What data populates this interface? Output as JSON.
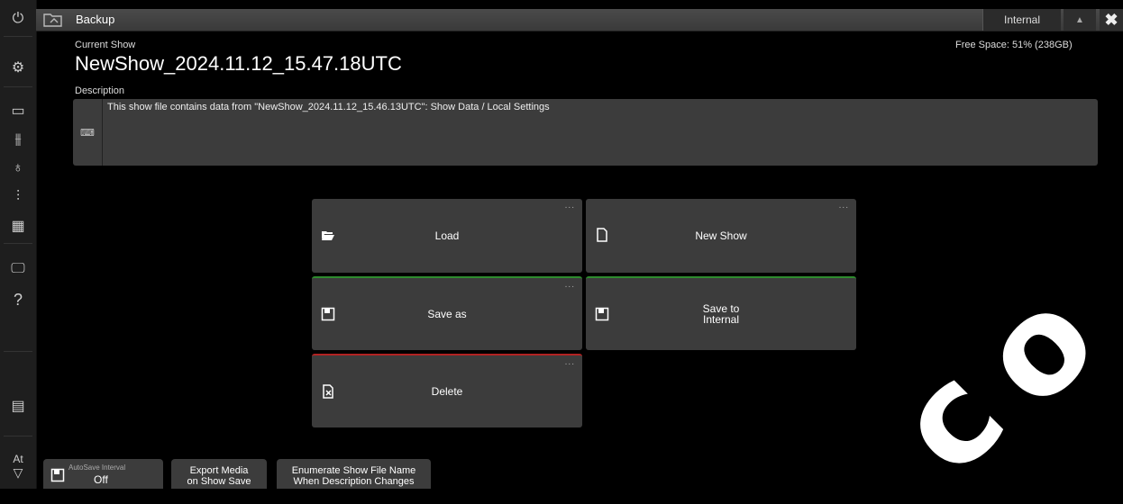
{
  "window": {
    "title": "Backup",
    "destination": "Internal",
    "eject_icon": "eject-icon",
    "close_icon": "close-icon"
  },
  "sidebar": {
    "items": [
      {
        "icon": "power-icon"
      },
      {
        "icon": "gear-icon"
      },
      {
        "icon": "window-icon"
      },
      {
        "icon": "faders-icon"
      },
      {
        "icon": "fixture-icon"
      },
      {
        "icon": "channel-sliders-icon"
      },
      {
        "icon": "grid-icon"
      },
      {
        "icon": "monitor-icon"
      },
      {
        "icon": "help-icon",
        "label": "?"
      },
      {
        "icon": "sheet-icon"
      },
      {
        "icon": "filter-icon",
        "label": "At"
      }
    ]
  },
  "show": {
    "current_label": "Current Show",
    "name": "NewShow_2024.11.12_15.47.18UTC",
    "free_space": "Free Space: 51% (238GB)",
    "description_label": "Description",
    "description": "This show file contains data from \"NewShow_2024.11.12_15.46.13UTC\": Show Data / Local Settings"
  },
  "actions": {
    "load": "Load",
    "new_show": "New Show",
    "save_as": "Save as",
    "save_to_internal_line1": "Save to",
    "save_to_internal_line2": "Internal",
    "delete": "Delete",
    "more": "..."
  },
  "bottom": {
    "autosave_label": "AutoSave Interval",
    "autosave_value": "Off",
    "export_media_line1": "Export Media",
    "export_media_line2": "on Show Save",
    "enumerate_line1": "Enumerate Show File Name",
    "enumerate_line2": "When Description Changes"
  },
  "colors": {
    "save_as_accent": "#2e8b2e",
    "delete_accent": "#b22222"
  }
}
